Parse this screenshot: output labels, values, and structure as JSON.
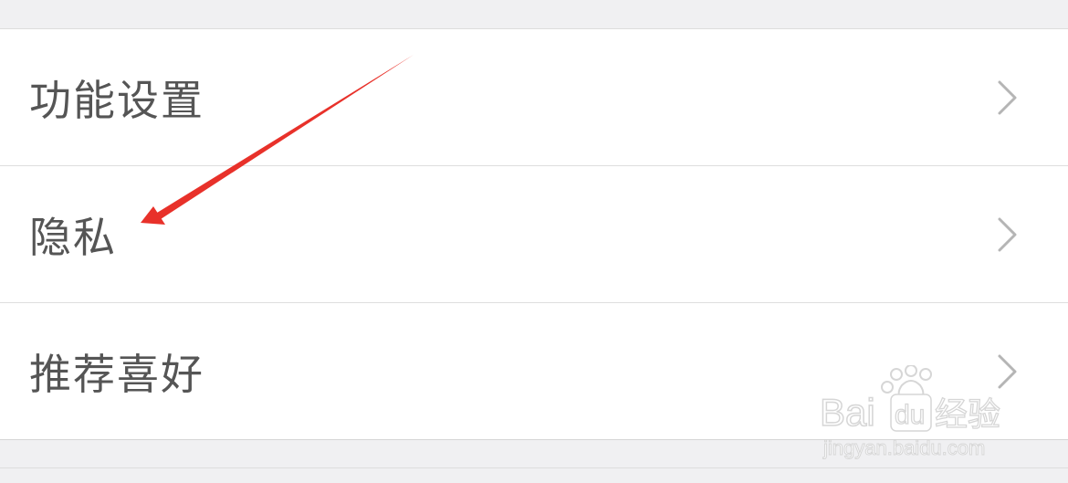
{
  "settings": {
    "items": [
      {
        "label": "功能设置",
        "icon": "chevron-right-icon"
      },
      {
        "label": "隐私",
        "icon": "chevron-right-icon"
      },
      {
        "label": "推荐喜好",
        "icon": "chevron-right-icon"
      }
    ]
  },
  "annotation": {
    "color": "#e8312a",
    "icon": "red-arrow-pointing-to-privacy"
  },
  "watermark": {
    "brand": "Baidu经验",
    "url": "jingyan.baidu.com"
  },
  "colors": {
    "background": "#f0f0f2",
    "row_background": "#ffffff",
    "label_text": "#555555",
    "chevron": "#b5b5b5",
    "divider": "#dedede"
  }
}
